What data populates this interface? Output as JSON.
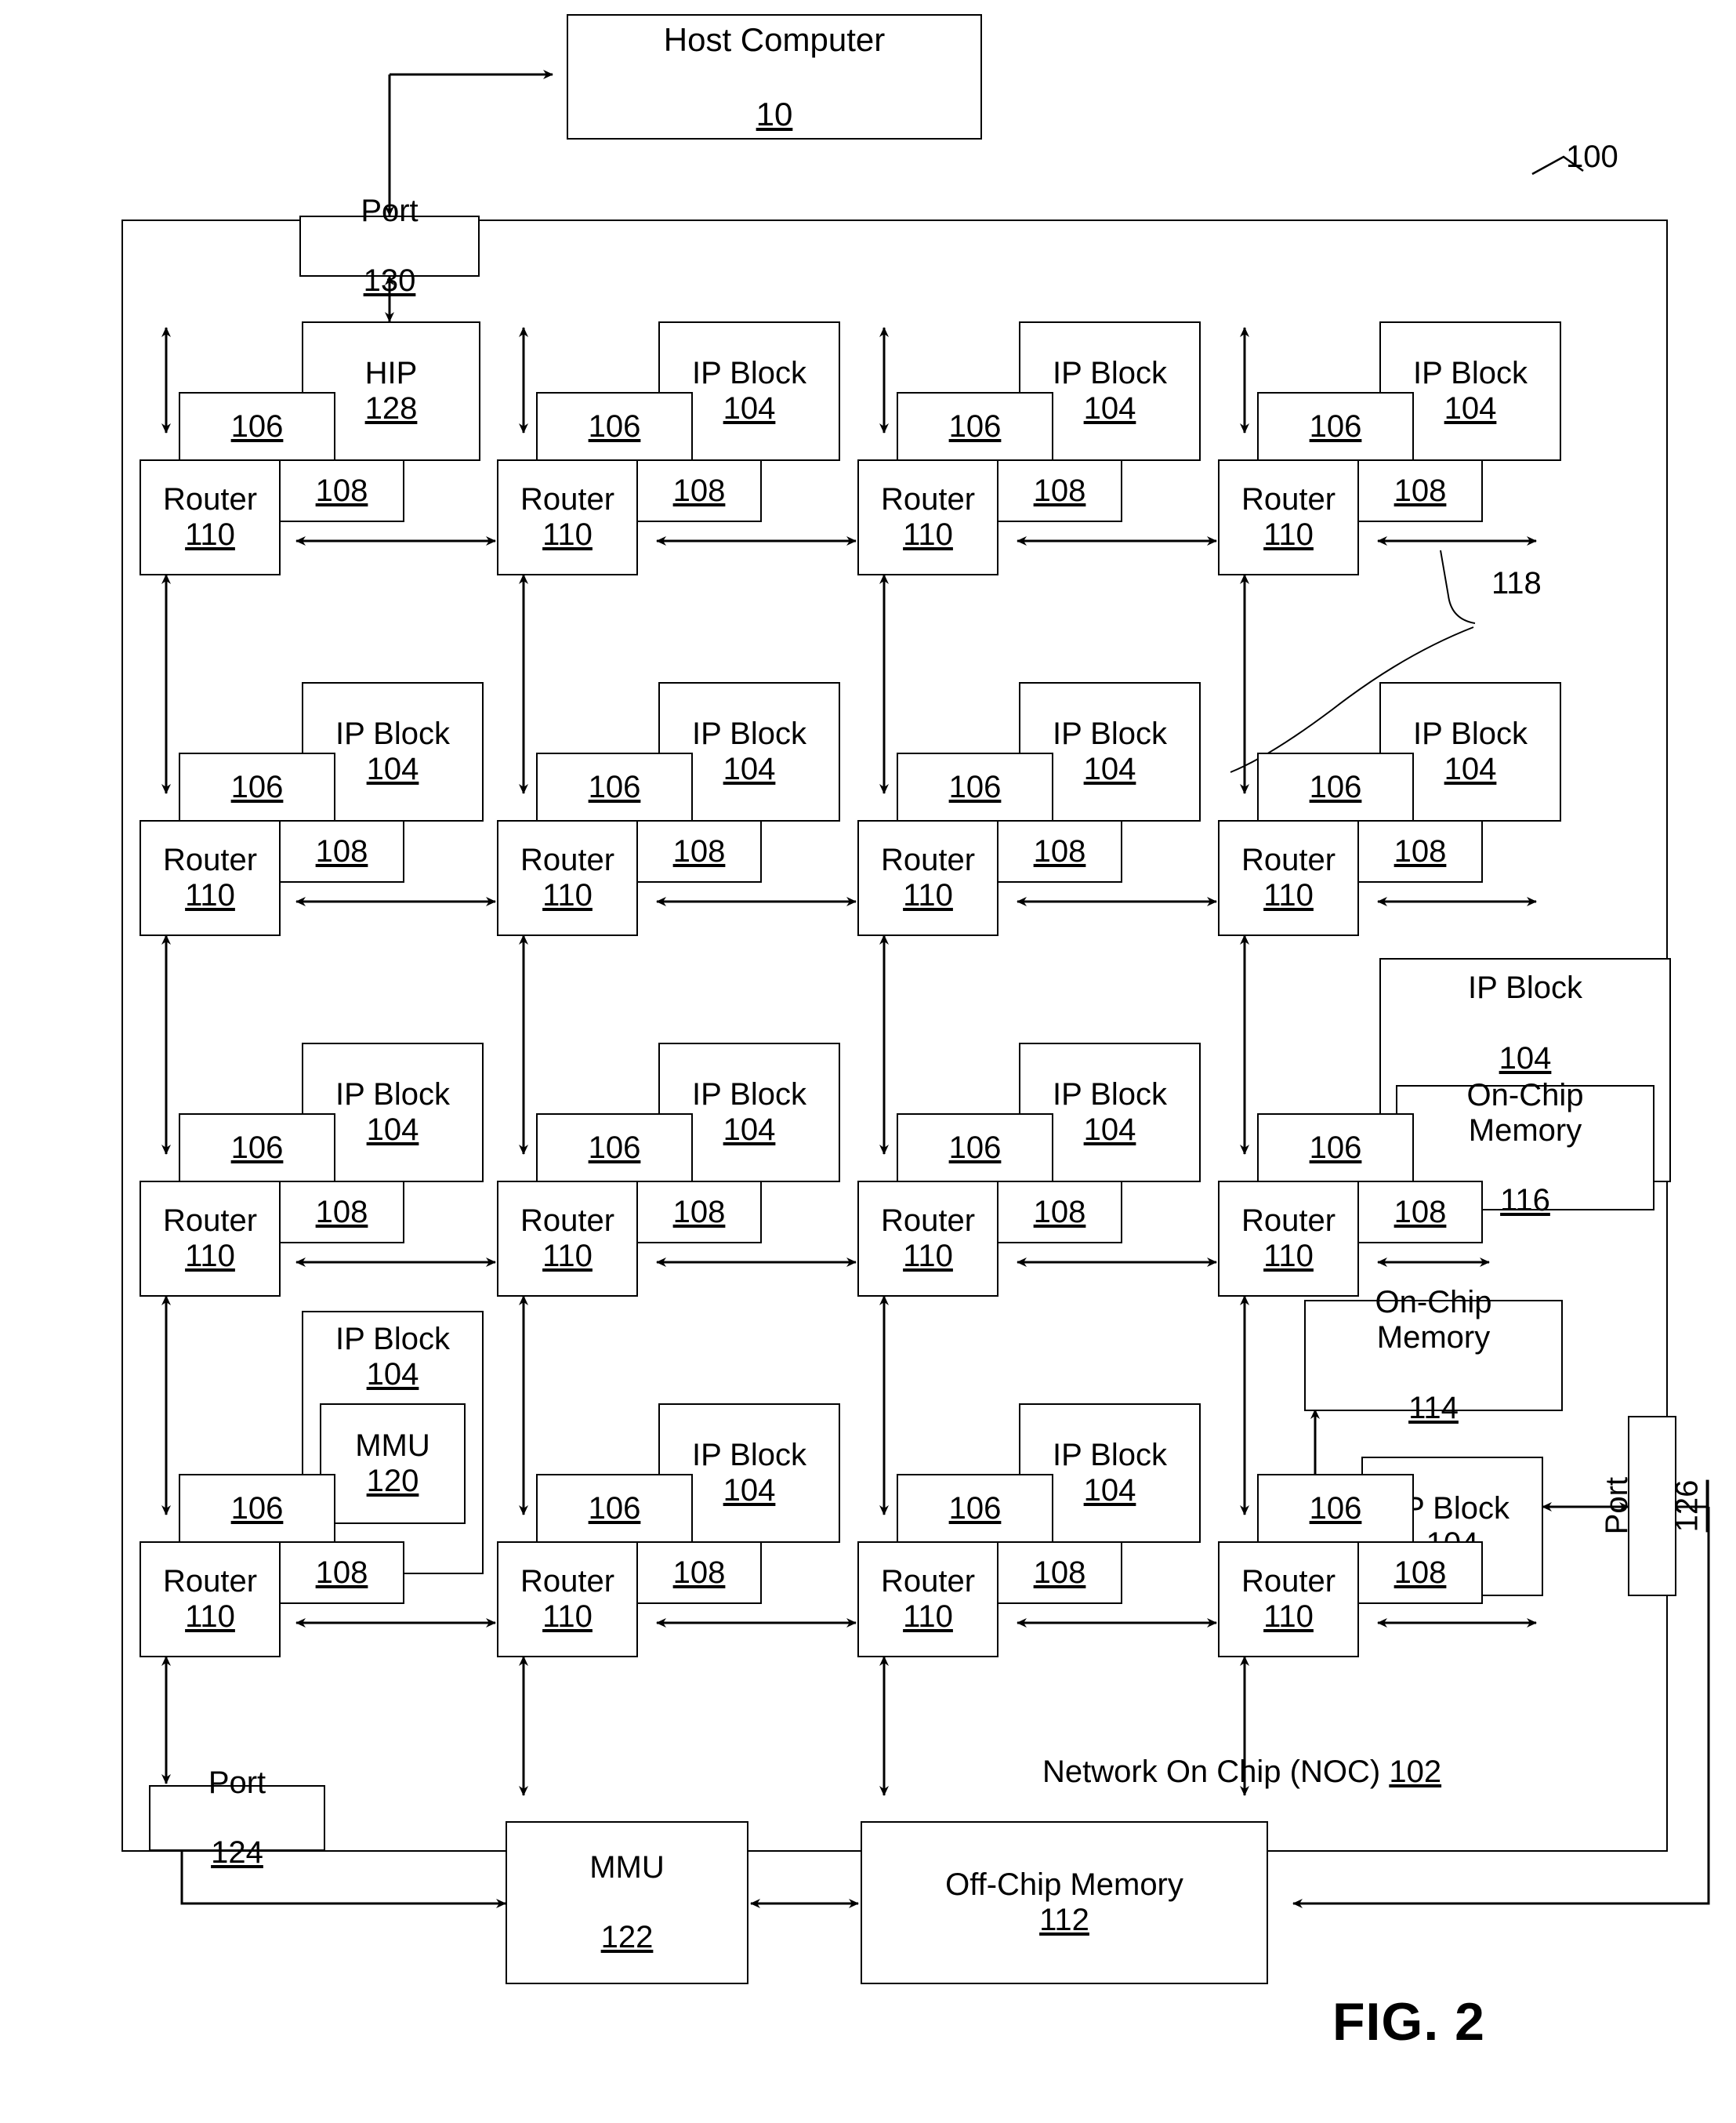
{
  "figure": {
    "label": "FIG. 2",
    "system_ref": "100"
  },
  "host": {
    "label": "Host Computer",
    "ref": "10"
  },
  "noc": {
    "label": "Network On Chip (NOC)",
    "ref": "102",
    "ports": {
      "top": {
        "label": "Port",
        "ref": "130"
      },
      "bottom": {
        "label": "Port",
        "ref": "124"
      },
      "right": {
        "label": "Port",
        "ref": "126"
      }
    }
  },
  "link": {
    "ref": "118"
  },
  "cell_parts": {
    "ip_block_label": "IP Block",
    "ip_block_ref": "104",
    "hip_label": "HIP",
    "hip_ref": "128",
    "adapter_ref": "106",
    "link_ref": "108",
    "router_label": "Router",
    "router_ref": "110"
  },
  "grid": {
    "rows": 4,
    "cols": 4,
    "cells": [
      [
        {
          "type": "hip",
          "title": "HIP",
          "ref": "128"
        },
        {
          "type": "ip",
          "title": "IP Block",
          "ref": "104"
        },
        {
          "type": "ip",
          "title": "IP Block",
          "ref": "104"
        },
        {
          "type": "ip",
          "title": "IP Block",
          "ref": "104"
        }
      ],
      [
        {
          "type": "ip",
          "title": "IP Block",
          "ref": "104"
        },
        {
          "type": "ip",
          "title": "IP Block",
          "ref": "104"
        },
        {
          "type": "ip",
          "title": "IP Block",
          "ref": "104"
        },
        {
          "type": "ip",
          "title": "IP Block",
          "ref": "104"
        }
      ],
      [
        {
          "type": "ip",
          "title": "IP Block",
          "ref": "104"
        },
        {
          "type": "ip",
          "title": "IP Block",
          "ref": "104"
        },
        {
          "type": "ip",
          "title": "IP Block",
          "ref": "104"
        },
        {
          "type": "ip_inline_mem",
          "title": "IP Block",
          "ref": "104",
          "inner": {
            "label": "On-Chip",
            "label2": "Memory",
            "ref": "116"
          }
        }
      ],
      [
        {
          "type": "ip_mmu",
          "title": "IP Block",
          "ref": "104",
          "inner": {
            "label": "MMU",
            "ref": "120"
          }
        },
        {
          "type": "ip",
          "title": "IP Block",
          "ref": "104"
        },
        {
          "type": "ip",
          "title": "IP Block",
          "ref": "104"
        },
        {
          "type": "ip",
          "title": "IP Block",
          "ref": "104"
        }
      ]
    ]
  },
  "onchip_memory_114": {
    "label": "On-Chip",
    "label2": "Memory",
    "ref": "114"
  },
  "offchip": {
    "mmu": {
      "label": "MMU",
      "ref": "122"
    },
    "memory": {
      "label": "Off-Chip  Memory",
      "ref": "112"
    }
  },
  "cells_flat": {
    "r0c0": {
      "title": "HIP",
      "ref": "128",
      "a": "106",
      "l": "108",
      "router": "Router",
      "rref": "110"
    },
    "r0c1": {
      "title": "IP Block",
      "ref": "104",
      "a": "106",
      "l": "108",
      "router": "Router",
      "rref": "110"
    },
    "r0c2": {
      "title": "IP Block",
      "ref": "104",
      "a": "106",
      "l": "108",
      "router": "Router",
      "rref": "110"
    },
    "r0c3": {
      "title": "IP Block",
      "ref": "104",
      "a": "106",
      "l": "108",
      "router": "Router",
      "rref": "110"
    },
    "r1c0": {
      "title": "IP Block",
      "ref": "104",
      "a": "106",
      "l": "108",
      "router": "Router",
      "rref": "110"
    },
    "r1c1": {
      "title": "IP Block",
      "ref": "104",
      "a": "106",
      "l": "108",
      "router": "Router",
      "rref": "110"
    },
    "r1c2": {
      "title": "IP Block",
      "ref": "104",
      "a": "106",
      "l": "108",
      "router": "Router",
      "rref": "110"
    },
    "r1c3": {
      "title": "IP Block",
      "ref": "104",
      "a": "106",
      "l": "108",
      "router": "Router",
      "rref": "110"
    },
    "r2c0": {
      "title": "IP Block",
      "ref": "104",
      "a": "106",
      "l": "108",
      "router": "Router",
      "rref": "110"
    },
    "r2c1": {
      "title": "IP Block",
      "ref": "104",
      "a": "106",
      "l": "108",
      "router": "Router",
      "rref": "110"
    },
    "r2c2": {
      "title": "IP Block",
      "ref": "104",
      "a": "106",
      "l": "108",
      "router": "Router",
      "rref": "110"
    },
    "r2c3": {
      "title": "IP Block",
      "ref": "104",
      "a": "106",
      "l": "108",
      "router": "Router",
      "rref": "110"
    },
    "r3c0": {
      "title": "IP Block",
      "ref": "104",
      "a": "106",
      "l": "108",
      "router": "Router",
      "rref": "110"
    },
    "r3c1": {
      "title": "IP Block",
      "ref": "104",
      "a": "106",
      "l": "108",
      "router": "Router",
      "rref": "110"
    },
    "r3c2": {
      "title": "IP Block",
      "ref": "104",
      "a": "106",
      "l": "108",
      "router": "Router",
      "rref": "110"
    },
    "r3c3": {
      "title": "IP Block",
      "ref": "104",
      "a": "106",
      "l": "108",
      "router": "Router",
      "rref": "110"
    }
  }
}
